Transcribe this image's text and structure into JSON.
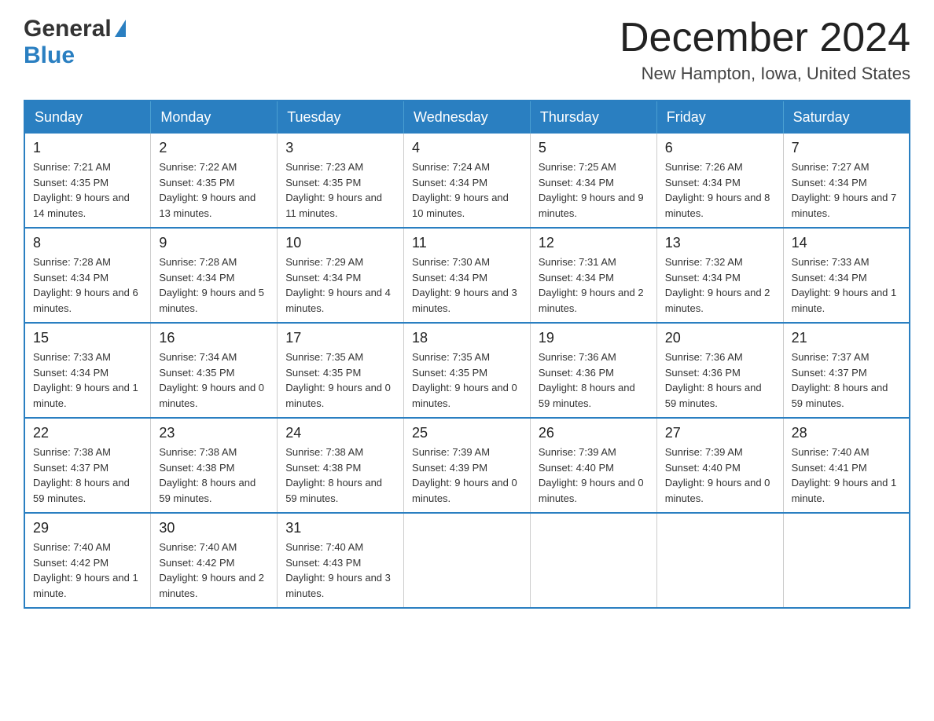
{
  "header": {
    "logo_general": "General",
    "logo_blue": "Blue",
    "title": "December 2024",
    "subtitle": "New Hampton, Iowa, United States"
  },
  "weekdays": [
    "Sunday",
    "Monday",
    "Tuesday",
    "Wednesday",
    "Thursday",
    "Friday",
    "Saturday"
  ],
  "weeks": [
    [
      {
        "day": "1",
        "sunrise": "7:21 AM",
        "sunset": "4:35 PM",
        "daylight": "9 hours and 14 minutes."
      },
      {
        "day": "2",
        "sunrise": "7:22 AM",
        "sunset": "4:35 PM",
        "daylight": "9 hours and 13 minutes."
      },
      {
        "day": "3",
        "sunrise": "7:23 AM",
        "sunset": "4:35 PM",
        "daylight": "9 hours and 11 minutes."
      },
      {
        "day": "4",
        "sunrise": "7:24 AM",
        "sunset": "4:34 PM",
        "daylight": "9 hours and 10 minutes."
      },
      {
        "day": "5",
        "sunrise": "7:25 AM",
        "sunset": "4:34 PM",
        "daylight": "9 hours and 9 minutes."
      },
      {
        "day": "6",
        "sunrise": "7:26 AM",
        "sunset": "4:34 PM",
        "daylight": "9 hours and 8 minutes."
      },
      {
        "day": "7",
        "sunrise": "7:27 AM",
        "sunset": "4:34 PM",
        "daylight": "9 hours and 7 minutes."
      }
    ],
    [
      {
        "day": "8",
        "sunrise": "7:28 AM",
        "sunset": "4:34 PM",
        "daylight": "9 hours and 6 minutes."
      },
      {
        "day": "9",
        "sunrise": "7:28 AM",
        "sunset": "4:34 PM",
        "daylight": "9 hours and 5 minutes."
      },
      {
        "day": "10",
        "sunrise": "7:29 AM",
        "sunset": "4:34 PM",
        "daylight": "9 hours and 4 minutes."
      },
      {
        "day": "11",
        "sunrise": "7:30 AM",
        "sunset": "4:34 PM",
        "daylight": "9 hours and 3 minutes."
      },
      {
        "day": "12",
        "sunrise": "7:31 AM",
        "sunset": "4:34 PM",
        "daylight": "9 hours and 2 minutes."
      },
      {
        "day": "13",
        "sunrise": "7:32 AM",
        "sunset": "4:34 PM",
        "daylight": "9 hours and 2 minutes."
      },
      {
        "day": "14",
        "sunrise": "7:33 AM",
        "sunset": "4:34 PM",
        "daylight": "9 hours and 1 minute."
      }
    ],
    [
      {
        "day": "15",
        "sunrise": "7:33 AM",
        "sunset": "4:34 PM",
        "daylight": "9 hours and 1 minute."
      },
      {
        "day": "16",
        "sunrise": "7:34 AM",
        "sunset": "4:35 PM",
        "daylight": "9 hours and 0 minutes."
      },
      {
        "day": "17",
        "sunrise": "7:35 AM",
        "sunset": "4:35 PM",
        "daylight": "9 hours and 0 minutes."
      },
      {
        "day": "18",
        "sunrise": "7:35 AM",
        "sunset": "4:35 PM",
        "daylight": "9 hours and 0 minutes."
      },
      {
        "day": "19",
        "sunrise": "7:36 AM",
        "sunset": "4:36 PM",
        "daylight": "8 hours and 59 minutes."
      },
      {
        "day": "20",
        "sunrise": "7:36 AM",
        "sunset": "4:36 PM",
        "daylight": "8 hours and 59 minutes."
      },
      {
        "day": "21",
        "sunrise": "7:37 AM",
        "sunset": "4:37 PM",
        "daylight": "8 hours and 59 minutes."
      }
    ],
    [
      {
        "day": "22",
        "sunrise": "7:38 AM",
        "sunset": "4:37 PM",
        "daylight": "8 hours and 59 minutes."
      },
      {
        "day": "23",
        "sunrise": "7:38 AM",
        "sunset": "4:38 PM",
        "daylight": "8 hours and 59 minutes."
      },
      {
        "day": "24",
        "sunrise": "7:38 AM",
        "sunset": "4:38 PM",
        "daylight": "8 hours and 59 minutes."
      },
      {
        "day": "25",
        "sunrise": "7:39 AM",
        "sunset": "4:39 PM",
        "daylight": "9 hours and 0 minutes."
      },
      {
        "day": "26",
        "sunrise": "7:39 AM",
        "sunset": "4:40 PM",
        "daylight": "9 hours and 0 minutes."
      },
      {
        "day": "27",
        "sunrise": "7:39 AM",
        "sunset": "4:40 PM",
        "daylight": "9 hours and 0 minutes."
      },
      {
        "day": "28",
        "sunrise": "7:40 AM",
        "sunset": "4:41 PM",
        "daylight": "9 hours and 1 minute."
      }
    ],
    [
      {
        "day": "29",
        "sunrise": "7:40 AM",
        "sunset": "4:42 PM",
        "daylight": "9 hours and 1 minute."
      },
      {
        "day": "30",
        "sunrise": "7:40 AM",
        "sunset": "4:42 PM",
        "daylight": "9 hours and 2 minutes."
      },
      {
        "day": "31",
        "sunrise": "7:40 AM",
        "sunset": "4:43 PM",
        "daylight": "9 hours and 3 minutes."
      },
      null,
      null,
      null,
      null
    ]
  ],
  "labels": {
    "sunrise": "Sunrise:",
    "sunset": "Sunset:",
    "daylight": "Daylight:"
  }
}
